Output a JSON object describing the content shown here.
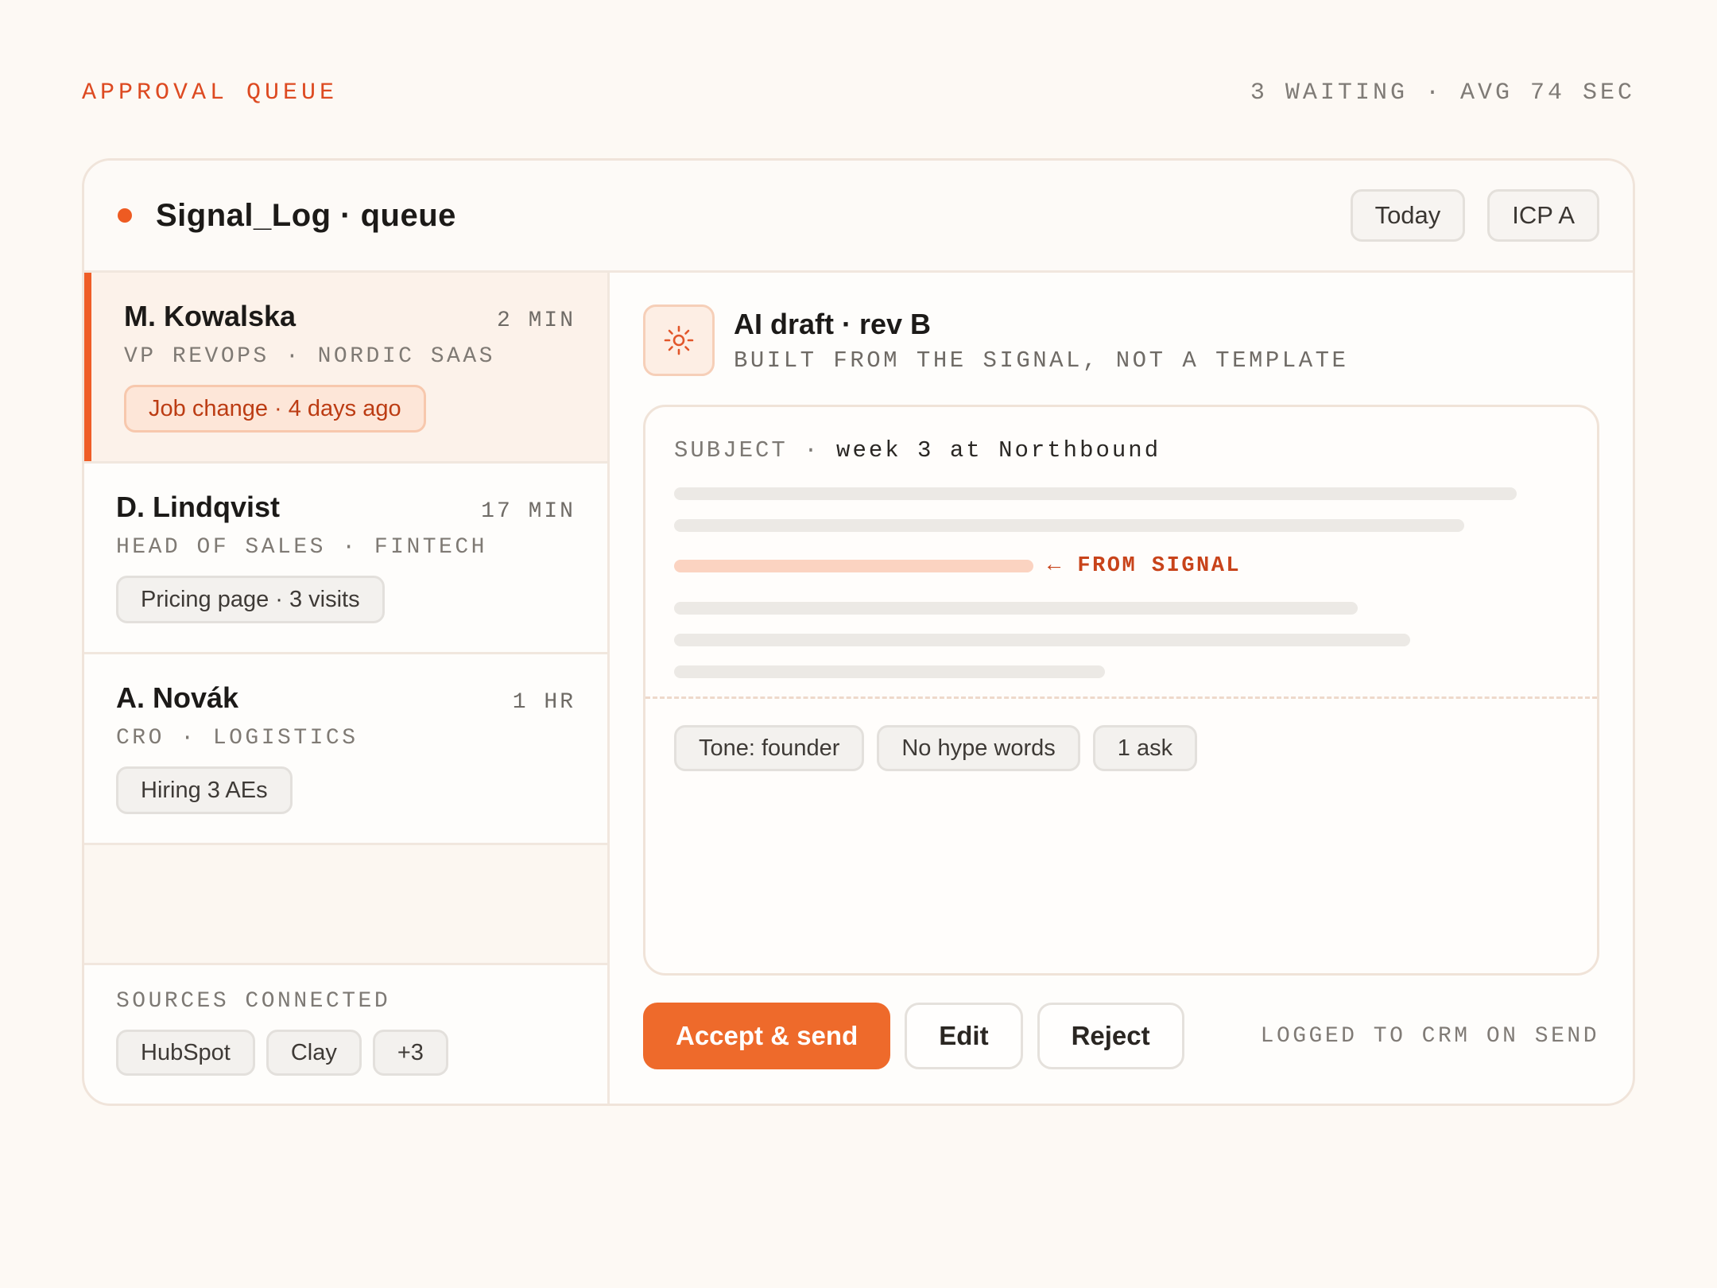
{
  "header": {
    "eyebrow": "APPROVAL QUEUE",
    "stats": "3 WAITING · AVG 74 SEC"
  },
  "card": {
    "title": "Signal_Log · queue",
    "filters": [
      "Today",
      "ICP A"
    ]
  },
  "leads": [
    {
      "name": "M. Kowalska",
      "time": "2 MIN",
      "role": "VP REVOPS · NORDIC SAAS",
      "tag": "Job change · 4 days ago",
      "active": true
    },
    {
      "name": "D. Lindqvist",
      "time": "17 MIN",
      "role": "HEAD OF SALES · FINTECH",
      "tag": "Pricing page · 3 visits",
      "active": false
    },
    {
      "name": "A. Novák",
      "time": "1 HR",
      "role": "CRO · LOGISTICS",
      "tag": "Hiring 3 AEs",
      "active": false
    }
  ],
  "sources": {
    "label": "SOURCES CONNECTED",
    "items": [
      "HubSpot",
      "Clay",
      "+3"
    ]
  },
  "draft": {
    "title": "AI draft · rev B",
    "subtitle": "BUILT FROM THE SIGNAL, NOT A TEMPLATE",
    "subject_label": "SUBJECT ·",
    "subject_value": "week 3 at Northbound",
    "signal_label": "← FROM SIGNAL",
    "rules": [
      "Tone: founder",
      "No hype words",
      "1 ask"
    ]
  },
  "actions": {
    "accept": "Accept & send",
    "edit": "Edit",
    "reject": "Reject",
    "note": "LOGGED TO CRM ON SEND"
  },
  "colors": {
    "accent": "#ee6a2b",
    "signal": "#bc3c13"
  },
  "icons": {
    "status": "dot-icon",
    "draft": "sun-icon"
  }
}
